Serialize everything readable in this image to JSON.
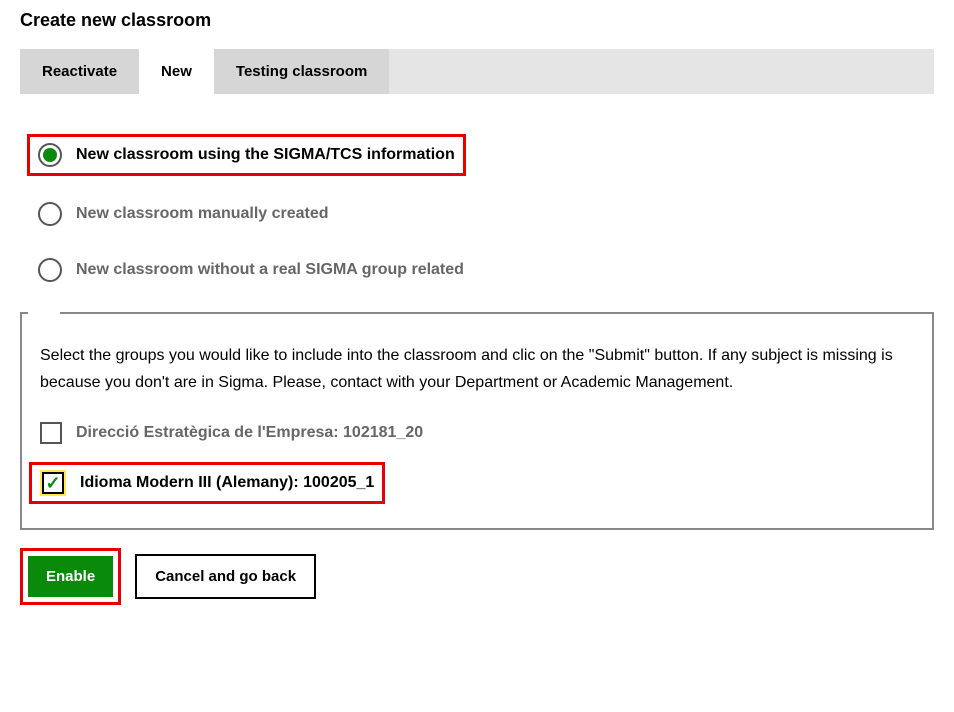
{
  "page_title": "Create new classroom",
  "tabs": {
    "reactivate": "Reactivate",
    "new": "New",
    "testing": "Testing classroom"
  },
  "radios": {
    "sigma": "New classroom using the SIGMA/TCS information",
    "manual": "New classroom manually created",
    "norel": "New classroom without a real SIGMA group related"
  },
  "help_text": "Select the groups you would like to include into the classroom and clic on the \"Submit\" button. If any subject is missing is because you don't are in Sigma. Please, contact with your Department or Academic Management.",
  "groups": {
    "g1": "Direcció Estratègica de l'Empresa: 102181_20",
    "g2": "Idioma Modern III (Alemany): 100205_1"
  },
  "buttons": {
    "enable": "Enable",
    "cancel": "Cancel and go back"
  }
}
